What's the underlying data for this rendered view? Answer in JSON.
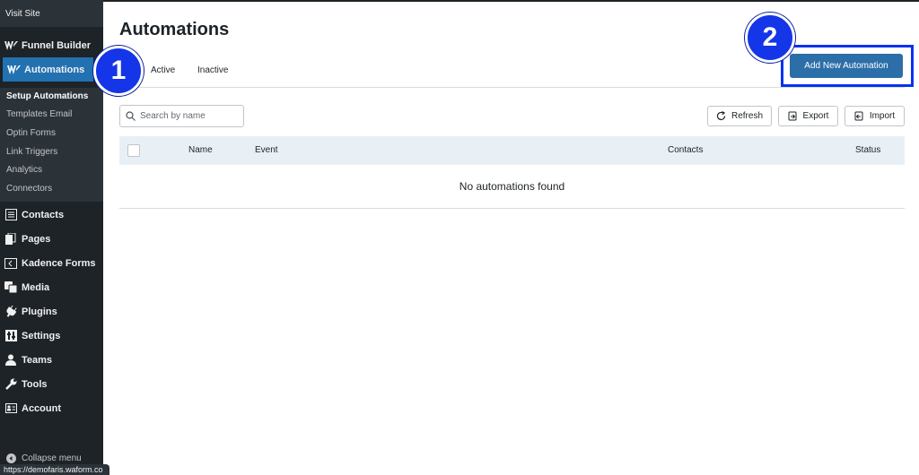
{
  "sidebar": {
    "visit_site": "Visit Site",
    "funnel_builder": "Funnel Builder",
    "automations": "Automations",
    "submenu": [
      {
        "label": "Setup Automations",
        "current": true
      },
      {
        "label": "Templates Email",
        "current": false
      },
      {
        "label": "Optin Forms",
        "current": false
      },
      {
        "label": "Link Triggers",
        "current": false
      },
      {
        "label": "Analytics",
        "current": false
      },
      {
        "label": "Connectors",
        "current": false
      }
    ],
    "items": [
      {
        "label": "Contacts",
        "icon": "contacts-icon"
      },
      {
        "label": "Pages",
        "icon": "pages-icon"
      },
      {
        "label": "Kadence Forms",
        "icon": "kadence-forms-icon"
      },
      {
        "label": "Media",
        "icon": "media-icon"
      },
      {
        "label": "Plugins",
        "icon": "plugins-icon"
      },
      {
        "label": "Settings",
        "icon": "settings-icon"
      },
      {
        "label": "Teams",
        "icon": "teams-icon"
      },
      {
        "label": "Tools",
        "icon": "tools-icon"
      },
      {
        "label": "Account",
        "icon": "account-icon"
      }
    ],
    "collapse": "Collapse menu"
  },
  "status_url": "https://demofaris.waform.co",
  "page": {
    "title": "Automations",
    "tabs": [
      "Active",
      "Inactive"
    ],
    "add_button": "Add New Automation",
    "search_placeholder": "Search by name",
    "refresh": "Refresh",
    "export": "Export",
    "import": "Import",
    "columns": [
      "Name",
      "Event",
      "Contacts",
      "Status"
    ],
    "empty": "No automations found"
  },
  "annotations": {
    "badge_1": "1",
    "badge_2": "2",
    "color": "#1535e8"
  },
  "colors": {
    "sidebar_bg": "#1d2327",
    "accent": "#2271b1",
    "add_button": "#2c6fa8"
  }
}
